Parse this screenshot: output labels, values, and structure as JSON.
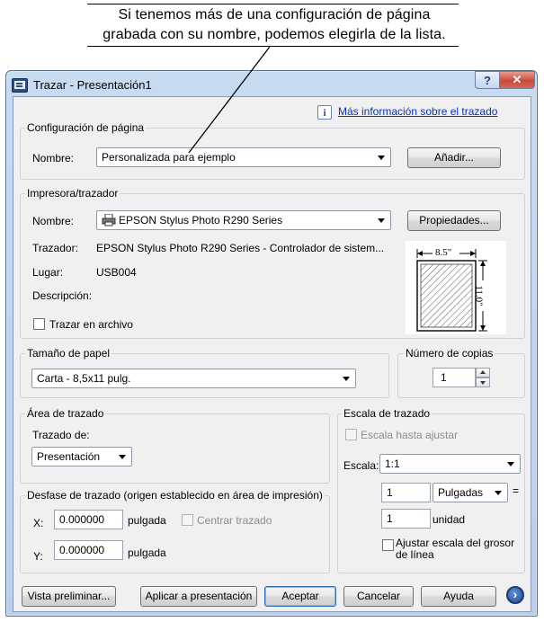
{
  "callout": {
    "line1": "Si tenemos más de una configuración de página",
    "line2": "grabada con su nombre, podemos elegirla de la lista."
  },
  "window": {
    "title": "Trazar - Presentación1",
    "help_glyph": "?",
    "close_glyph": "✕"
  },
  "info": {
    "icon_glyph": "i",
    "link": "Más información sobre el trazado"
  },
  "page_setup": {
    "legend": "Configuración de página",
    "name_label": "Nombre:",
    "name_value": "Personalizada para ejemplo",
    "add_button": "Añadir..."
  },
  "printer": {
    "legend": "Impresora/trazador",
    "name_label": "Nombre:",
    "name_value": "EPSON Stylus Photo R290 Series",
    "properties_button": "Propiedades...",
    "plotter_label": "Trazador:",
    "plotter_value": "EPSON Stylus Photo R290 Series - Controlador de sistem...",
    "where_label": "Lugar:",
    "where_value": "USB004",
    "description_label": "Descripción:",
    "plot_to_file_label": "Trazar en archivo",
    "preview_width": "8.5\"",
    "preview_height": "11.0\""
  },
  "paper_size": {
    "legend": "Tamaño de papel",
    "value": "Carta - 8,5x11 pulg."
  },
  "copies": {
    "legend": "Número de copias",
    "value": "1"
  },
  "plot_area": {
    "legend": "Área de trazado",
    "what_label": "Trazado de:",
    "what_value": "Presentación"
  },
  "plot_scale": {
    "legend": "Escala de trazado",
    "fit_label": "Escala hasta ajustar",
    "scale_label": "Escala:",
    "scale_value": "1:1",
    "value1": "1",
    "units_value": "Pulgadas",
    "equals": "=",
    "value2": "1",
    "unit_label": "unidad",
    "lineweights_label": "Ajustar escala del grosor de línea"
  },
  "plot_offset": {
    "legend": "Desfase de trazado (origen establecido en área de impresión)",
    "x_label": "X:",
    "x_value": "0.000000",
    "x_unit": "pulgada",
    "center_label": "Centrar trazado",
    "y_label": "Y:",
    "y_value": "0.000000",
    "y_unit": "pulgada"
  },
  "footer": {
    "preview_button": "Vista preliminar...",
    "apply_button": "Aplicar a presentación",
    "ok_button": "Aceptar",
    "cancel_button": "Cancelar",
    "help_button": "Ayuda",
    "more_glyph": "›"
  }
}
